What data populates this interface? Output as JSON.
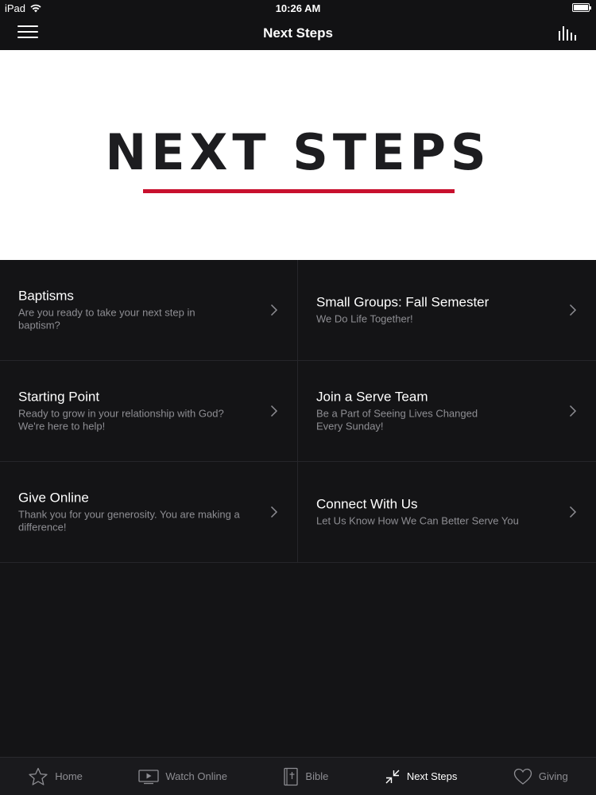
{
  "status_bar": {
    "carrier": "iPad",
    "time": "10:26 AM"
  },
  "nav": {
    "title": "Next Steps",
    "menu_icon": "hamburger-menu-icon",
    "right_icon": "bar-chart-icon"
  },
  "hero": {
    "title": "NEXT STEPS",
    "accent_color": "#c8102e"
  },
  "items": [
    {
      "title": "Baptisms",
      "subtitle": "Are you ready to take your next step in baptism?"
    },
    {
      "title": "Small Groups: Fall Semester",
      "subtitle": "We Do Life Together!"
    },
    {
      "title": "Starting Point",
      "subtitle": "Ready to grow in your relationship with God? We're here to help!"
    },
    {
      "title": "Join a Serve Team",
      "subtitle": "Be a Part of Seeing Lives Changed Every Sunday!"
    },
    {
      "title": "Give Online",
      "subtitle": "Thank you for your generosity. You are making a difference!"
    },
    {
      "title": "Connect With Us",
      "subtitle": "Let Us Know How We Can Better Serve You"
    }
  ],
  "tabs": [
    {
      "label": "Home",
      "icon": "star-icon",
      "active": false
    },
    {
      "label": "Watch Online",
      "icon": "video-icon",
      "active": false
    },
    {
      "label": "Bible",
      "icon": "bible-icon",
      "active": false
    },
    {
      "label": "Next Steps",
      "icon": "next-steps-icon",
      "active": true
    },
    {
      "label": "Giving",
      "icon": "heart-icon",
      "active": false
    }
  ]
}
